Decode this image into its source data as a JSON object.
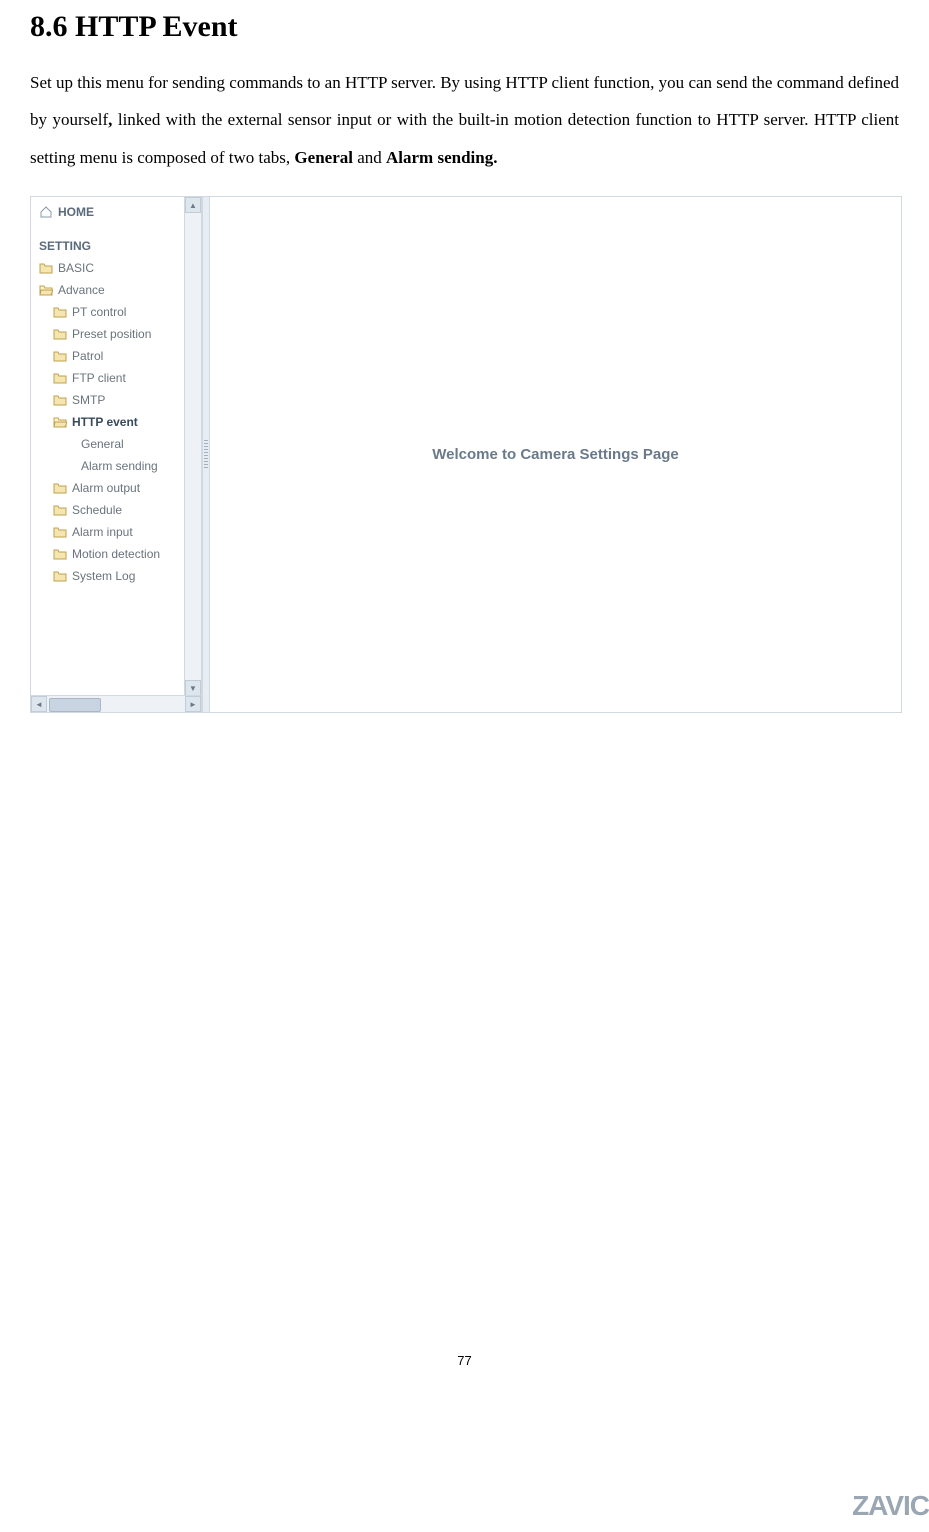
{
  "doc": {
    "heading": "8.6 HTTP Event",
    "paragraph_part1": "Set up this menu for sending commands to an HTTP server. By using HTTP client function, you can send the command defined by yourself",
    "paragraph_bold1": ",",
    "paragraph_part2": " linked with the external sensor input or with the built-in motion detection function to HTTP server. HTTP client setting menu is composed of two tabs, ",
    "paragraph_bold2": "General",
    "paragraph_part3": " and ",
    "paragraph_bold3": "Alarm sending.",
    "page_number": "77",
    "logo": "ZAVIC"
  },
  "ui": {
    "home": "HOME",
    "section": "SETTING",
    "tree": {
      "basic": "BASIC",
      "advance": "Advance",
      "advance_children": {
        "pt_control": "PT control",
        "preset_position": "Preset position",
        "patrol": "Patrol",
        "ftp_client": "FTP client",
        "smtp": "SMTP",
        "http_event": "HTTP event",
        "http_event_children": {
          "general": "General",
          "alarm_sending": "Alarm sending"
        },
        "alarm_output": "Alarm output",
        "schedule": "Schedule",
        "alarm_input": "Alarm input",
        "motion_detection": "Motion detection",
        "system_log": "System Log"
      }
    },
    "content": {
      "welcome": "Welcome to Camera Settings Page"
    }
  }
}
